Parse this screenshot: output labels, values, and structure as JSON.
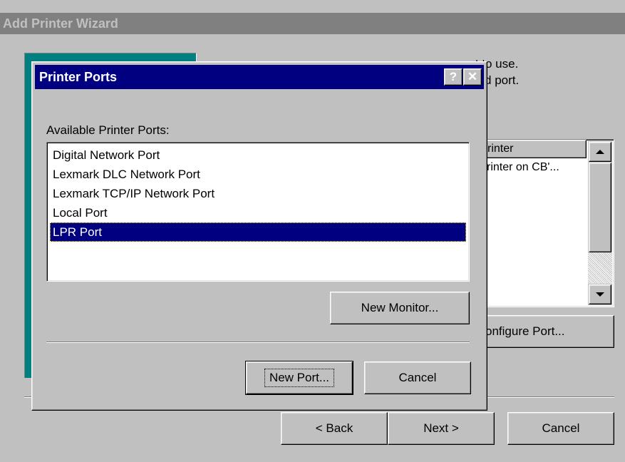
{
  "wizard": {
    "title": "Add Printer Wizard",
    "instruction_line1": "ou want to use.",
    "instruction_line2": "e checked port.",
    "list_header": "rinter",
    "list_row": "rinter on CB'...",
    "configure_port": "onfigure Port...",
    "back_button": "< Back",
    "next_button": "Next >",
    "cancel_button": "Cancel"
  },
  "dialog": {
    "title": "Printer Ports",
    "help_icon": "?",
    "close_icon": "✕",
    "available_label": "Available Printer Ports:",
    "ports": [
      "Digital Network Port",
      "Lexmark DLC Network Port",
      "Lexmark TCP/IP Network Port",
      "Local Port",
      "LPR Port"
    ],
    "selected_port": "LPR Port",
    "new_monitor_button": "New Monitor...",
    "new_port_button": "New Port...",
    "cancel_button": "Cancel"
  },
  "colors": {
    "title_active": "#000080",
    "title_inactive": "#808080",
    "face": "#c0c0c0",
    "banner": "#008080"
  }
}
